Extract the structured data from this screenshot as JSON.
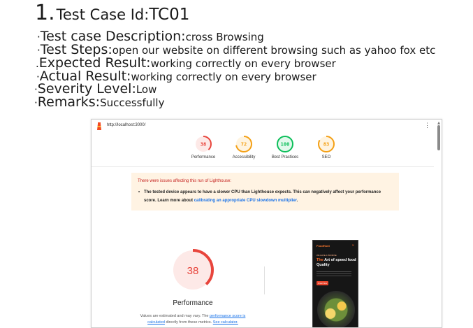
{
  "doc": {
    "number": "1.",
    "title_label": "Test Case Id:",
    "title_value": "TC01",
    "fields": [
      {
        "bullet": "·",
        "label": "Test case Description:",
        "value": "cross Browsing"
      },
      {
        "bullet": "·",
        "label": "Test Steps:",
        "value": "open  our website on different browsing such as yahoo fox etc"
      },
      {
        "bullet": ".",
        "label": "Expected Result:",
        "value": "working correctly on every browser"
      },
      {
        "bullet": "·",
        "label": "Actual Result:",
        "value": "working correctly on every browser"
      },
      {
        "bullet": "·",
        "label": "Severity Level:",
        "value": "Low"
      },
      {
        "bullet": "·",
        "label": "Remarks:",
        "value": "Successfully"
      }
    ]
  },
  "lighthouse": {
    "url": "http://localhost:3000/",
    "menu_glyph": "⋮",
    "scores": [
      {
        "label": "Performance",
        "score": 38,
        "color": "#e8453c",
        "bg": "#fde9e7"
      },
      {
        "label": "Accessibility",
        "score": 72,
        "color": "#f4a015",
        "bg": "#fff4e0"
      },
      {
        "label": "Best Practices",
        "score": 100,
        "color": "#0cbf5a",
        "bg": "#e3f8ec"
      },
      {
        "label": "SEO",
        "score": 83,
        "color": "#f4a015",
        "bg": "#fff4e0"
      }
    ],
    "warning": {
      "title": "There were issues affecting this run of Lighthouse:",
      "bullet_text": "The tested device appears to have a slower CPU than Lighthouse expects. This can negatively affect your performance score. Learn more about ",
      "link_text": "calibrating an appropriate CPU slowdown multiplier",
      "tail": "."
    },
    "main_gauge": {
      "score": 38,
      "label": "Performance",
      "color": "#e8453c",
      "bg": "#fde9e7"
    },
    "note": {
      "part1": "Values are estimated and may vary. The ",
      "link1": "performance score is calculated",
      "part2": " directly from these metrics. ",
      "link2": "See calculator."
    },
    "preview": {
      "brand": "FoodHunt",
      "kicker": "WE HAVE A PROMISE",
      "head_highlight": "The",
      "head_rest": " Art of speed food Quality",
      "button": "Order Now"
    }
  }
}
